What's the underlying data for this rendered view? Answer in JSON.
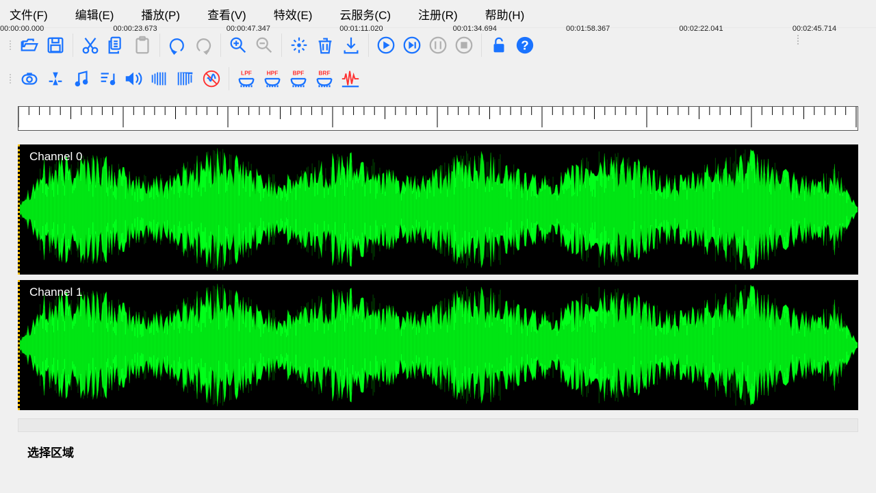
{
  "menu": {
    "file": "文件(F)",
    "edit": "编辑(E)",
    "play": "播放(P)",
    "view": "查看(V)",
    "effects": "特效(E)",
    "cloud": "云服务(C)",
    "register": "注册(R)",
    "help": "帮助(H)"
  },
  "toolbar": {
    "open": "open",
    "save": "save",
    "cut": "cut",
    "copy": "copy",
    "paste": "paste",
    "undo": "undo",
    "redo": "redo",
    "zoom_in": "zoom-in",
    "zoom_out": "zoom-out",
    "effects": "effects",
    "delete": "delete",
    "export": "export",
    "play": "play",
    "play_loop": "play-loop",
    "pause": "pause",
    "stop": "stop",
    "unlock": "unlock",
    "help": "help"
  },
  "toolbar2": {
    "record": "record",
    "normalize": "normalize",
    "music": "music",
    "sort": "sort",
    "volume": "volume",
    "fade_in": "fade-in",
    "fade_out": "fade-out",
    "noise": "noise-reduction",
    "lpf": "LPF",
    "hpf": "HPF",
    "bpf": "BPF",
    "brf": "BRF",
    "waveform": "waveform"
  },
  "timeline": {
    "labels": [
      "00:00:00.000",
      "00:00:23.673",
      "00:00:47.347",
      "00:01:11.020",
      "00:01:34.694",
      "00:01:58.367",
      "00:02:22.041",
      "00:02:45.714"
    ]
  },
  "channels": {
    "ch0": "Channel 0",
    "ch1": "Channel 1"
  },
  "bottom_label": "选择区域",
  "colors": {
    "accent": "#1a73ff",
    "waveform": "#00ff1a",
    "bg": "#000000"
  }
}
